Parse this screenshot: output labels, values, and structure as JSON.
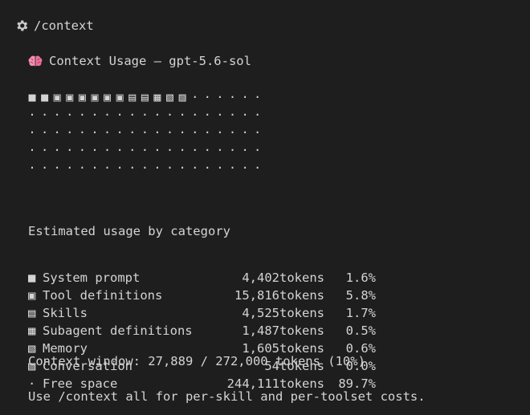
{
  "command": {
    "icon": "gear-icon",
    "text": "/context"
  },
  "header": {
    "icon": "brain-icon",
    "title": "Context Usage — gpt-5.6-sol"
  },
  "grid": {
    "rows": [
      [
        "■",
        "■",
        "▣",
        "▣",
        "▣",
        "▣",
        "▣",
        "▣",
        "▤",
        "▤",
        "▦",
        "▧",
        "▨",
        "·",
        "·",
        "·",
        "·",
        "·",
        "·"
      ],
      [
        "·",
        "·",
        "·",
        "·",
        "·",
        "·",
        "·",
        "·",
        "·",
        "·",
        "·",
        "·",
        "·",
        "·",
        "·",
        "·",
        "·",
        "·",
        "·"
      ],
      [
        "·",
        "·",
        "·",
        "·",
        "·",
        "·",
        "·",
        "·",
        "·",
        "·",
        "·",
        "·",
        "·",
        "·",
        "·",
        "·",
        "·",
        "·",
        "·"
      ],
      [
        "·",
        "·",
        "·",
        "·",
        "·",
        "·",
        "·",
        "·",
        "·",
        "·",
        "·",
        "·",
        "·",
        "·",
        "·",
        "·",
        "·",
        "·",
        "·"
      ],
      [
        "·",
        "·",
        "·",
        "·",
        "·",
        "·",
        "·",
        "·",
        "·",
        "·",
        "·",
        "·",
        "·",
        "·",
        "·",
        "·",
        "·",
        "·",
        "·"
      ]
    ]
  },
  "usage": {
    "heading": "Estimated usage by category",
    "categories": [
      {
        "glyph": "■",
        "name": "System prompt",
        "tokens": "4,402",
        "unit": "tokens",
        "percent": "1.6%"
      },
      {
        "glyph": "▣",
        "name": "Tool definitions",
        "tokens": "15,816",
        "unit": "tokens",
        "percent": "5.8%"
      },
      {
        "glyph": "▤",
        "name": "Skills",
        "tokens": "4,525",
        "unit": "tokens",
        "percent": "1.7%"
      },
      {
        "glyph": "▦",
        "name": "Subagent definitions",
        "tokens": "1,487",
        "unit": "tokens",
        "percent": "0.5%"
      },
      {
        "glyph": "▧",
        "name": "Memory",
        "tokens": "1,605",
        "unit": "tokens",
        "percent": "0.6%"
      },
      {
        "glyph": "▨",
        "name": "Conversation",
        "tokens": "54",
        "unit": "tokens",
        "percent": "0.0%"
      },
      {
        "glyph": "·",
        "name": "Free space",
        "tokens": "244,111",
        "unit": "tokens",
        "percent": "89.7%"
      }
    ]
  },
  "context_window": "Context window: 27,889 / 272,000 tokens (10%)",
  "hint": "Use /context all for per-skill and per-toolset costs.",
  "colors": {
    "background": "#1e1e1e",
    "text": "#d4d4d4",
    "gear": "#c9c9c9",
    "brain": "#f48fb1"
  }
}
